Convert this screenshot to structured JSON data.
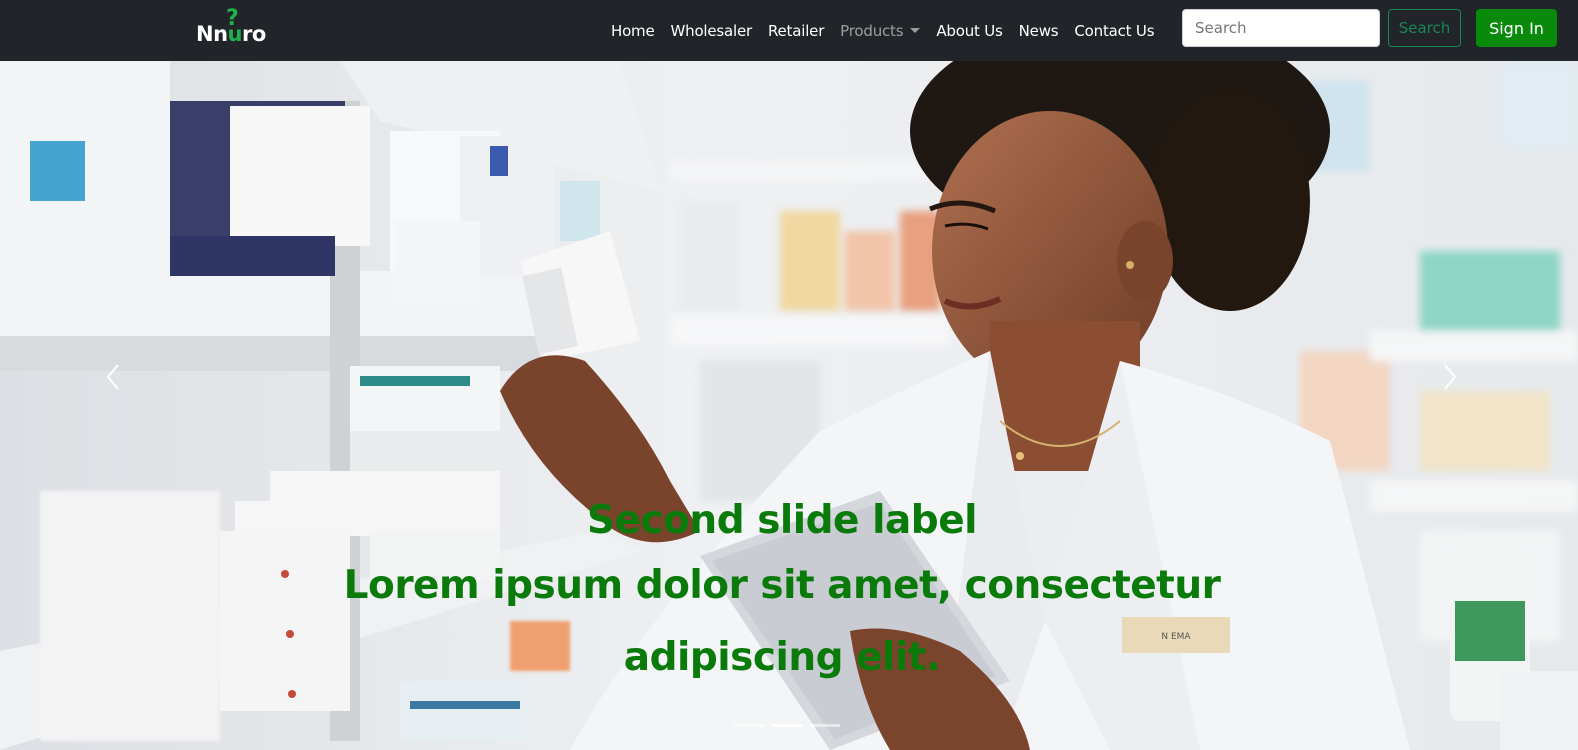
{
  "brand": {
    "name_prefix": "Nn",
    "name_u": "u",
    "name_suffix": "ro",
    "mark": "?"
  },
  "nav": {
    "items": [
      {
        "label": "Home"
      },
      {
        "label": "Wholesaler"
      },
      {
        "label": "Retailer"
      },
      {
        "label": "Products"
      },
      {
        "label": "About Us"
      },
      {
        "label": "News"
      },
      {
        "label": "Contact Us"
      }
    ]
  },
  "search": {
    "placeholder": "Search",
    "button_label": "Search"
  },
  "auth": {
    "signin_label": "Sign In"
  },
  "carousel": {
    "active_index": 1,
    "slide_count": 3,
    "caption_title": "Second slide label",
    "caption_text": "Lorem ipsum dolor sit amet, consectetur adipiscing elit.",
    "badge_text": "N EMA"
  },
  "colors": {
    "navbar_bg": "#212529",
    "accent_green": "#0a8a0a",
    "caption_green": "#0a7a0a",
    "brand_green": "#1db24a"
  },
  "icons": {
    "prev": "chevron-left-icon",
    "next": "chevron-right-icon"
  }
}
